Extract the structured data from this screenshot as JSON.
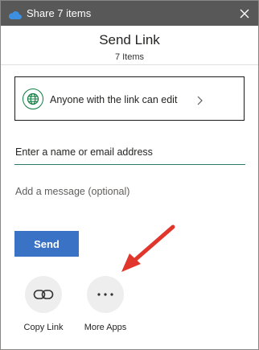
{
  "window": {
    "title": "Share 7 items",
    "icon": "onedrive-cloud-icon",
    "close_icon": "close-icon"
  },
  "header": {
    "title": "Send Link",
    "subtitle": "7 Items"
  },
  "permission": {
    "label": "Anyone with the link can edit",
    "icon": "globe-icon",
    "chevron_icon": "chevron-right-icon"
  },
  "name_input": {
    "placeholder": "Enter a name or email address",
    "value": ""
  },
  "message_input": {
    "placeholder": "Add a message (optional)",
    "value": ""
  },
  "send_button": {
    "label": "Send"
  },
  "apps": [
    {
      "label": "Copy Link",
      "icon": "link-icon"
    },
    {
      "label": "More Apps",
      "icon": "ellipsis-icon"
    }
  ],
  "colors": {
    "titlebar": "#585858",
    "send_button": "#3a73c6",
    "globe": "#107c41",
    "input_underline": "#2a7a6e",
    "annotation_arrow": "#e0362c"
  }
}
